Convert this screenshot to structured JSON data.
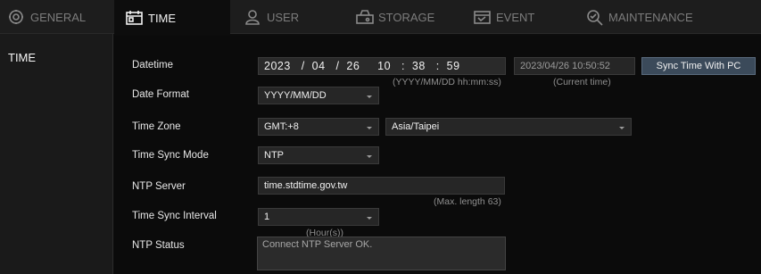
{
  "nav": {
    "tabs": [
      {
        "label": "GENERAL",
        "icon": "gear-icon"
      },
      {
        "label": "TIME",
        "icon": "calendar-icon"
      },
      {
        "label": "USER",
        "icon": "user-icon"
      },
      {
        "label": "STORAGE",
        "icon": "storage-icon"
      },
      {
        "label": "EVENT",
        "icon": "event-icon"
      },
      {
        "label": "MAINTENANCE",
        "icon": "maintenance-icon"
      }
    ],
    "active": "TIME"
  },
  "sidebar": {
    "items": [
      {
        "label": "TIME"
      }
    ]
  },
  "form": {
    "datetime": {
      "label": "Datetime",
      "value": "2023   /  04   /  26     10   :  38   :  59",
      "hint": "(YYYY/MM/DD hh:mm:ss)",
      "pc_time": "2023/04/26 10:50:52",
      "pc_time_hint": "(Current time)",
      "sync_button": "Sync Time With PC"
    },
    "date_format": {
      "label": "Date Format",
      "value": "YYYY/MM/DD"
    },
    "time_zone": {
      "label": "Time Zone",
      "offset": "GMT:+8",
      "region": "Asia/Taipei"
    },
    "time_sync_mode": {
      "label": "Time Sync Mode",
      "value": "NTP"
    },
    "ntp_server": {
      "label": "NTP Server",
      "value": "time.stdtime.gov.tw",
      "hint": "(Max. length 63)"
    },
    "time_sync_interval": {
      "label": "Time Sync Interval",
      "value": "1",
      "hint": "(Hour(s))"
    },
    "ntp_status": {
      "label": "NTP Status",
      "value": "Connect NTP Server OK."
    }
  }
}
